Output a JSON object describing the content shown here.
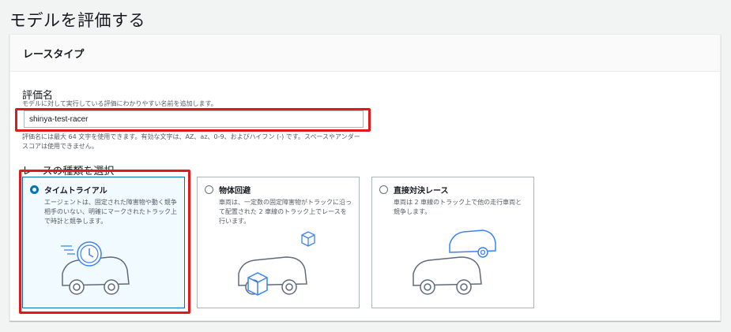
{
  "page": {
    "title": "モデルを評価する"
  },
  "panel": {
    "header": "レースタイプ"
  },
  "model_name": {
    "label": "評価名",
    "description": "モデルに対して実行している評価にわかりやすい名前を追加します。",
    "value": "shinya-test-racer",
    "help": "評価名には最大 64 文字を使用できます。有効な文字は、AZ、az、0-9、およびハイフン (-) です。スペースやアンダースコアは使用できません。"
  },
  "race_type": {
    "label": "レースの種類を選択",
    "options": [
      {
        "title": "タイムトライアル",
        "description": "エージェントは、固定された障害物や動く競争相手のいない、明確にマークされたトラック上で時計と競争します。",
        "selected": true
      },
      {
        "title": "物体回避",
        "description": "車両は、一定数の固定障害物がトラックに沿って配置された 2 車線のトラック上でレースを行います。",
        "selected": false
      },
      {
        "title": "直接対決レース",
        "description": "車両は 2 車線のトラック上で他の走行車両と競争します。",
        "selected": false
      }
    ]
  },
  "colors": {
    "highlight": "#e01a1a",
    "accent": "#0073bb",
    "icon_blue": "#3b82f6",
    "icon_gray": "#5f6b7a"
  }
}
